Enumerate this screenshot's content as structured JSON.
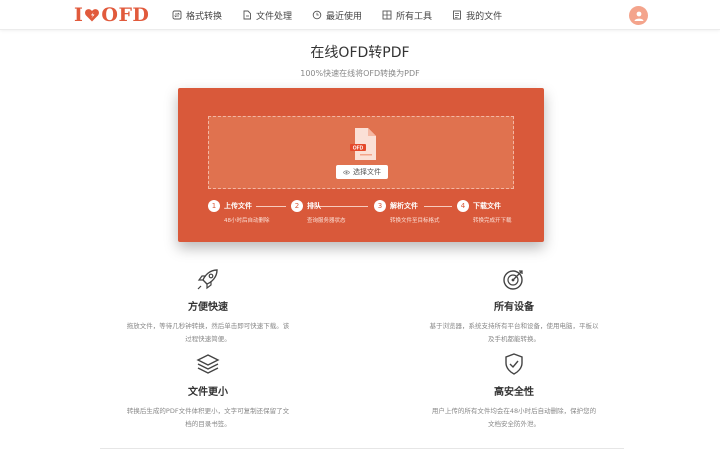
{
  "header": {
    "logo": {
      "left": "I",
      "right": "OFD"
    },
    "nav": [
      {
        "icon": "convert-icon",
        "label": "格式转换"
      },
      {
        "icon": "file-process-icon",
        "label": "文件处理"
      },
      {
        "icon": "clock-icon",
        "label": "最近使用"
      },
      {
        "icon": "tools-icon",
        "label": "所有工具"
      },
      {
        "icon": "my-file-icon",
        "label": "我的文件"
      }
    ]
  },
  "main": {
    "title": "在线OFD转PDF",
    "subtitle": "100%快速在线将OFD转换为PDF"
  },
  "upload": {
    "file_badge": "OFD",
    "select_button": "选择文件",
    "steps": [
      {
        "num": "1",
        "title": "上传文件",
        "desc": "48小时后自动删除"
      },
      {
        "num": "2",
        "title": "排队",
        "desc": "查询服务器状态"
      },
      {
        "num": "3",
        "title": "解析文件",
        "desc": "转换文件至目标格式"
      },
      {
        "num": "4",
        "title": "下载文件",
        "desc": "转换完成开下载"
      }
    ]
  },
  "features": [
    {
      "icon": "rocket-icon",
      "title": "方便快速",
      "desc_lines": [
        "拖放文件，等待几秒钟转换，然后单击即可快速下载。该",
        "过程快速简便。"
      ]
    },
    {
      "icon": "target-icon",
      "title": "所有设备",
      "desc_lines": [
        "基于浏览器，系统支持所有平台和设备，使用电脑，平板以",
        "及手机都能转换。"
      ]
    },
    {
      "icon": "layers-icon",
      "title": "文件更小",
      "desc_lines": [
        "转换后生成的PDF文件体积更小，文字可复制还保留了文",
        "档的目录书签。"
      ]
    },
    {
      "icon": "shield-icon",
      "title": "高安全性",
      "desc_lines": [
        "用户上传的所有文件均会在48小时后自动删除，保护您的",
        "文档安全防外泄。"
      ]
    }
  ],
  "colors": {
    "brand": "#e15a3c",
    "panel": "#d9593a",
    "avatar": "#f4a48c"
  }
}
